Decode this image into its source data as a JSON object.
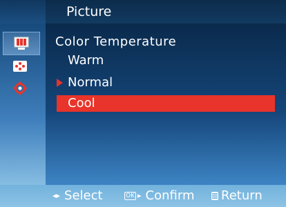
{
  "header": {
    "title": "Picture"
  },
  "sidebar": {
    "items": [
      {
        "icon": "picture-icon",
        "selected": true
      },
      {
        "icon": "color-dots-icon",
        "selected": false
      },
      {
        "icon": "settings-gear-icon",
        "selected": false
      }
    ]
  },
  "main": {
    "section_title": "Color Temperature",
    "options": [
      {
        "label": "Warm",
        "state": "normal"
      },
      {
        "label": "Normal",
        "state": "current"
      },
      {
        "label": "Cool",
        "state": "highlighted"
      }
    ]
  },
  "footer": {
    "select_label": "Select",
    "ok_icon_text": "OK",
    "confirm_label": "Confirm",
    "return_label": "Return"
  },
  "colors": {
    "highlight": "#e8342a",
    "header_bg": "#0c2c4c",
    "footer_bg": "#8dc3e6"
  }
}
